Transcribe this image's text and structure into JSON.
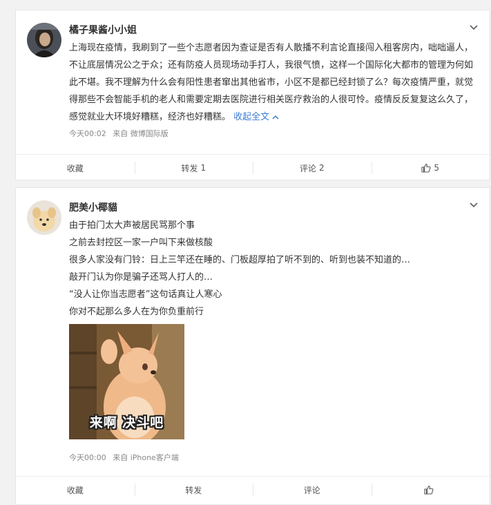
{
  "posts": [
    {
      "author": "橘子果酱小小姐",
      "text": "上海现在疫情，我刷到了一些个志愿者因为查证是否有人散播不利言论直接闯入租客房内，咄咄逼人，不让底层情况公之于众；还有防疫人员现场动手打人，我很气愤，这样一个国际化大都市的管理为何如此不堪。我不理解为什么会有阳性患者窜出其他省市，小区不是都已经封锁了么？每次疫情严重，就觉得那些不会智能手机的老人和需要定期去医院进行相关医疗救治的人很可怜。疫情反反复复这么久了，感觉就业大环境好糟糕，经济也好糟糕。",
      "collapse_label": "收起全文",
      "time": "今天00:02",
      "source": "来自 微博国际版",
      "actions": {
        "favorite": "收藏",
        "repost": "转发",
        "repost_count": "1",
        "comment": "评论",
        "comment_count": "2",
        "like_count": "5"
      }
    },
    {
      "author": "肥美小椰貓",
      "lines": [
        "由于拍门太大声被居民骂那个事",
        "之前去封控区一家一户叫下来做核酸",
        "很多人家没有门铃：日上三竿还在睡的、门板超厚拍了听不到的、听到也装不知道的…",
        "敲开门认为你是骗子还骂人打人的…",
        "“没人让你当志愿者”这句话真让人寒心",
        "你对不起那么多人在为你负重前行"
      ],
      "image_caption": "来啊 决斗吧",
      "time": "今天00:00",
      "source": "来自 iPhone客户端",
      "actions": {
        "favorite": "收藏",
        "repost": "转发",
        "comment": "评论"
      }
    }
  ],
  "icons": {
    "chevron": "chevron-down-icon",
    "like": "thumbs-up-icon"
  },
  "colors": {
    "link": "#3a7bd5",
    "meta": "#888888",
    "page_bg": "#f2f2f2"
  }
}
